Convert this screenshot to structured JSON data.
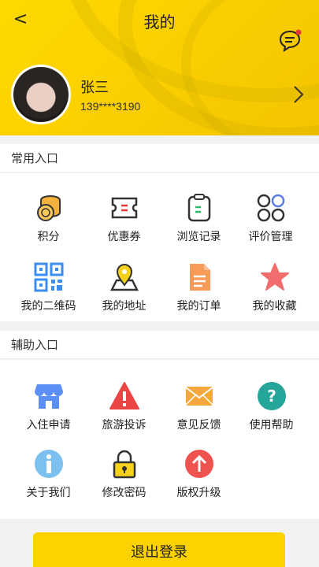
{
  "header": {
    "back_symbol": "<",
    "title": "我的",
    "message_icon": "chat-bubble-icon",
    "accent_color": "#ffd900"
  },
  "user": {
    "name": "张三",
    "phone": "139****3190"
  },
  "common": {
    "title": "常用入口",
    "items": [
      {
        "label": "积分",
        "icon": "coins-icon"
      },
      {
        "label": "优惠券",
        "icon": "coupon-icon"
      },
      {
        "label": "浏览记录",
        "icon": "clipboard-icon"
      },
      {
        "label": "评价管理",
        "icon": "grid-circles-icon"
      },
      {
        "label": "我的二维码",
        "icon": "qr-code-icon"
      },
      {
        "label": "我的地址",
        "icon": "location-pin-icon"
      },
      {
        "label": "我的订单",
        "icon": "document-icon"
      },
      {
        "label": "我的收藏",
        "icon": "star-icon"
      }
    ]
  },
  "aux": {
    "title": "辅助入口",
    "items": [
      {
        "label": "入住申请",
        "icon": "shop-icon"
      },
      {
        "label": "旅游投诉",
        "icon": "warning-icon"
      },
      {
        "label": "意见反馈",
        "icon": "envelope-icon"
      },
      {
        "label": "使用帮助",
        "icon": "question-icon"
      },
      {
        "label": "关于我们",
        "icon": "info-icon"
      },
      {
        "label": "修改密码",
        "icon": "lock-icon"
      },
      {
        "label": "版权升级",
        "icon": "upgrade-arrow-icon"
      }
    ]
  },
  "logout_label": "退出登录"
}
